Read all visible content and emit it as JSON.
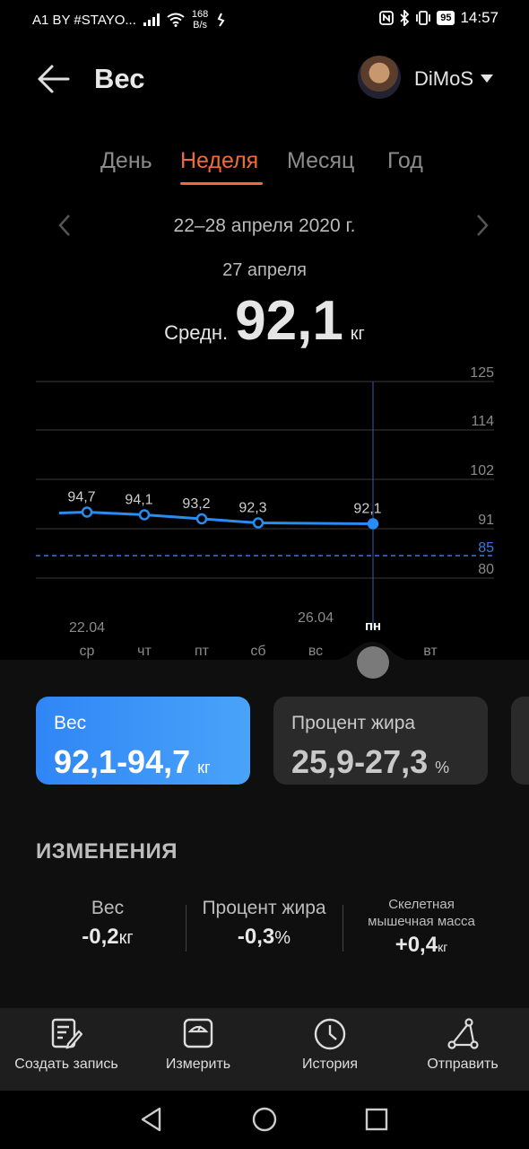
{
  "status_bar": {
    "carrier": "A1 BY #STAYO...",
    "speed_value": "168",
    "speed_unit": "B/s",
    "battery": "95",
    "time": "14:57"
  },
  "header": {
    "title": "Вес",
    "user_name": "DiMoS"
  },
  "tabs": [
    {
      "label": "День",
      "active": false
    },
    {
      "label": "Неделя",
      "active": true
    },
    {
      "label": "Месяц",
      "active": false
    },
    {
      "label": "Год",
      "active": false
    }
  ],
  "period": {
    "range": "22–28 апреля 2020 г.",
    "selected_date": "27 апреля",
    "avg_label": "Средн.",
    "avg_value": "92,1",
    "avg_unit": "кг"
  },
  "chart_data": {
    "type": "line",
    "categories": [
      "ср",
      "чт",
      "пт",
      "сб",
      "вс",
      "пн",
      "вт"
    ],
    "x_date_labels": {
      "ср": "22.04",
      "вс": "26.04"
    },
    "series": [
      {
        "values": [
          94.7,
          94.1,
          93.2,
          92.3,
          null,
          92.1,
          null
        ]
      }
    ],
    "point_labels": [
      "94,7",
      "94,1",
      "93,2",
      "92,3",
      "",
      "92,1",
      ""
    ],
    "y_ticks": [
      "125",
      "114",
      "102",
      "91",
      "80"
    ],
    "target_value": 85,
    "target_label": "85",
    "ylim": [
      80,
      125
    ],
    "selected_category": "пн",
    "line_color": "#2a8cf0",
    "target_color": "#3b78d8"
  },
  "cards": [
    {
      "title": "Вес",
      "value": "92,1-94,7",
      "unit": "кг",
      "active": true
    },
    {
      "title": "Процент жира",
      "value": "25,9-27,3",
      "unit": "%",
      "active": false
    }
  ],
  "changes": {
    "title": "ИЗМЕНЕНИЯ",
    "items": [
      {
        "label": "Вес",
        "value": "-0,2",
        "unit": "кг"
      },
      {
        "label": "Процент жира",
        "value": "-0,3",
        "unit": "%"
      },
      {
        "label": "Скелетная мышечная масса",
        "value": "+0,4",
        "unit": "кг"
      }
    ]
  },
  "actions": [
    {
      "label": "Создать запись",
      "icon": "edit-note-icon"
    },
    {
      "label": "Измерить",
      "icon": "scale-icon"
    },
    {
      "label": "История",
      "icon": "clock-icon"
    },
    {
      "label": "Отправить",
      "icon": "share-icon"
    }
  ],
  "colors": {
    "accent": "#f16a38",
    "card_blue": "#2f86f6"
  }
}
